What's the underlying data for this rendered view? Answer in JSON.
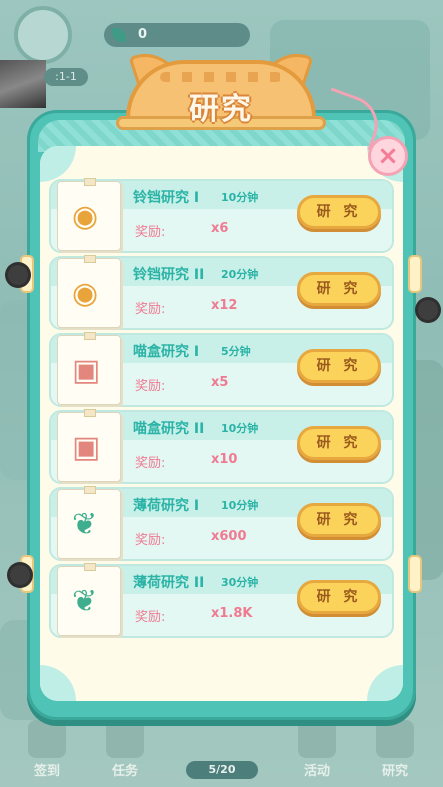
{
  "title": "研究",
  "close_label": "×",
  "background": {
    "currency_value": "0",
    "level_label": ":1-1",
    "progress_label": "5/20",
    "bottom_items": [
      "签到",
      "任务",
      "活动",
      "研究"
    ]
  },
  "reward_label": "奖励:",
  "research_button_label": "研 究",
  "research_items": [
    {
      "name": "铃铛研究 I",
      "time": "10分钟",
      "reward": "x6",
      "icon": "bell-icon"
    },
    {
      "name": "铃铛研究 II",
      "time": "20分钟",
      "reward": "x12",
      "icon": "bell-icon"
    },
    {
      "name": "喵盒研究 I",
      "time": "5分钟",
      "reward": "x5",
      "icon": "gift-box-icon"
    },
    {
      "name": "喵盒研究 II",
      "time": "10分钟",
      "reward": "x10",
      "icon": "gift-box-icon"
    },
    {
      "name": "薄荷研究 I",
      "time": "10分钟",
      "reward": "x600",
      "icon": "mint-leaf-icon"
    },
    {
      "name": "薄荷研究 II",
      "time": "30分钟",
      "reward": "x1.8K",
      "icon": "mint-leaf-icon"
    }
  ],
  "colors": {
    "panel": "#4fc3b5",
    "title_banner": "#f7c173",
    "button": "#fbd35b",
    "reward_text": "#f07a92",
    "name_text": "#2ab3a6"
  }
}
